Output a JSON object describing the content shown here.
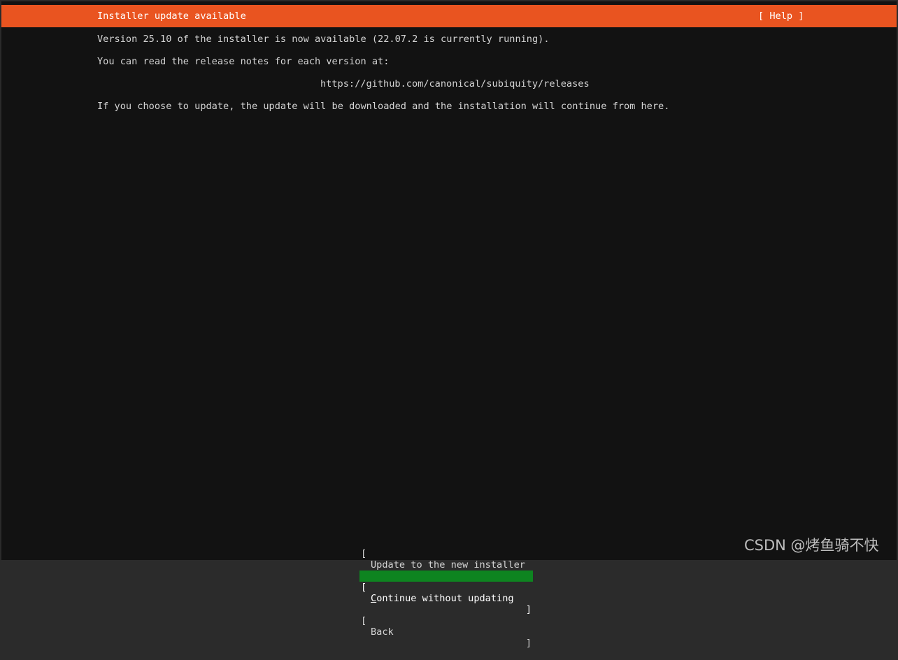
{
  "header": {
    "title": "Installer update available",
    "help_label": "[ Help ]"
  },
  "body": {
    "version_line": "Version 25.10 of the installer is now available (22.07.2 is currently running).",
    "notes_line": "You can read the release notes for each version at:",
    "url": "https://github.com/canonical/subiquity/releases",
    "update_line": "If you choose to update, the update will be downloaded and the installation will continue from here."
  },
  "buttons": {
    "update": {
      "label": "Update to the new installer"
    },
    "continue": {
      "first_char": "C",
      "rest": "ontinue without updating"
    },
    "back": {
      "label": "Back"
    }
  },
  "watermark": "CSDN @烤鱼骑不快",
  "colors": {
    "accent": "#e95420",
    "focus": "#0e8420",
    "background": "#121212"
  }
}
